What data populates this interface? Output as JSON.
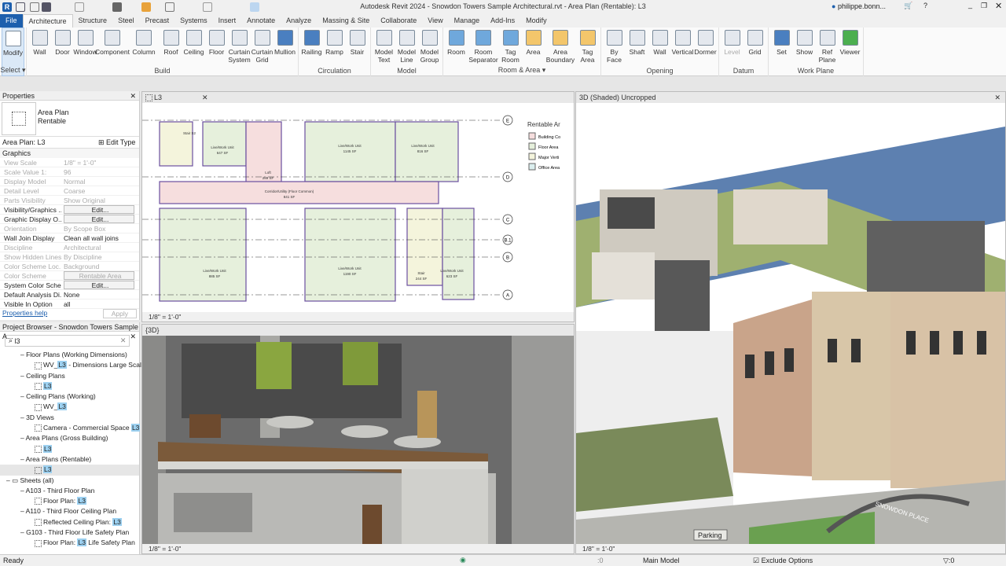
{
  "app": {
    "title": "Autodesk Revit 2024 - Snowdon Towers Sample Architectural.rvt - Area Plan (Rentable): L3",
    "user": "philippe.bonn...",
    "logo": "R"
  },
  "tabs": [
    "File",
    "Architecture",
    "Structure",
    "Steel",
    "Precast",
    "Systems",
    "Insert",
    "Annotate",
    "Analyze",
    "Massing & Site",
    "Collaborate",
    "View",
    "Manage",
    "Add-Ins",
    "Modify"
  ],
  "active_tab": "Architecture",
  "ribbon": [
    {
      "panel": "Select ▾",
      "buttons": [
        {
          "label": "Modify",
          "icon": "cursor-icon",
          "sel": true
        }
      ]
    },
    {
      "panel": "Build",
      "buttons": [
        {
          "label": "Wall",
          "icon": "wall-icon"
        },
        {
          "label": "Door",
          "icon": "door-icon"
        },
        {
          "label": "Window",
          "icon": "window-icon"
        },
        {
          "label": "Component",
          "icon": "component-icon",
          "wide": true
        },
        {
          "label": "Column",
          "icon": "column-icon",
          "wide": true
        },
        {
          "label": "Roof",
          "icon": "roof-icon"
        },
        {
          "label": "Ceiling",
          "icon": "ceiling-icon"
        },
        {
          "label": "Floor",
          "icon": "floor-icon"
        },
        {
          "label": "Curtain\nSystem",
          "icon": "curtain-system-icon"
        },
        {
          "label": "Curtain\nGrid",
          "icon": "curtain-grid-icon"
        },
        {
          "label": "Mullion",
          "icon": "mullion-icon"
        }
      ]
    },
    {
      "panel": "Circulation",
      "buttons": [
        {
          "label": "Railing",
          "icon": "railing-icon"
        },
        {
          "label": "Ramp",
          "icon": "ramp-icon"
        },
        {
          "label": "Stair",
          "icon": "stair-icon"
        }
      ]
    },
    {
      "panel": "Model",
      "buttons": [
        {
          "label": "Model\nText",
          "icon": "model-text-icon"
        },
        {
          "label": "Model\nLine",
          "icon": "model-line-icon"
        },
        {
          "label": "Model\nGroup",
          "icon": "model-group-icon"
        }
      ]
    },
    {
      "panel": "Room & Area ▾",
      "buttons": [
        {
          "label": "Room",
          "icon": "room-icon"
        },
        {
          "label": "Room\nSeparator",
          "icon": "room-separator-icon",
          "wide": true
        },
        {
          "label": "Tag\nRoom",
          "icon": "tag-room-icon"
        },
        {
          "label": "Area",
          "icon": "area-icon"
        },
        {
          "label": "Area\nBoundary",
          "icon": "area-boundary-icon",
          "wide": true
        },
        {
          "label": "Tag\nArea",
          "icon": "tag-area-icon"
        }
      ]
    },
    {
      "panel": "Opening",
      "buttons": [
        {
          "label": "By\nFace",
          "icon": "by-face-icon"
        },
        {
          "label": "Shaft",
          "icon": "shaft-icon"
        },
        {
          "label": "Wall",
          "icon": "wall-opening-icon"
        },
        {
          "label": "Vertical",
          "icon": "vertical-icon"
        },
        {
          "label": "Dormer",
          "icon": "dormer-icon"
        }
      ]
    },
    {
      "panel": "Datum",
      "buttons": [
        {
          "label": "Level",
          "icon": "level-icon",
          "dis": true
        },
        {
          "label": "Grid",
          "icon": "grid-icon"
        }
      ]
    },
    {
      "panel": "Work Plane",
      "buttons": [
        {
          "label": "Set",
          "icon": "set-icon"
        },
        {
          "label": "Show",
          "icon": "show-icon"
        },
        {
          "label": "Ref\nPlane",
          "icon": "ref-plane-icon"
        },
        {
          "label": "Viewer",
          "icon": "viewer-icon"
        }
      ]
    }
  ],
  "properties": {
    "header": "Properties",
    "type_line1": "Area Plan",
    "type_line2": "Rentable",
    "instance": "Area Plan: L3",
    "edit_type": "Edit Type",
    "group": "Graphics",
    "help": "Properties help",
    "apply": "Apply",
    "rows": [
      {
        "k": "View Scale",
        "v": "1/8\" = 1'-0\"",
        "gray": true
      },
      {
        "k": "Scale Value    1:",
        "v": "96",
        "gray": true
      },
      {
        "k": "Display Model",
        "v": "Normal",
        "gray": true
      },
      {
        "k": "Detail Level",
        "v": "Coarse",
        "gray": true
      },
      {
        "k": "Parts Visibility",
        "v": "Show Original",
        "gray": true
      },
      {
        "k": "Visibility/Graphics ...",
        "v": "Edit...",
        "btn": true
      },
      {
        "k": "Graphic Display O...",
        "v": "Edit...",
        "btn": true
      },
      {
        "k": "Orientation",
        "v": "By Scope Box",
        "gray": true
      },
      {
        "k": "Wall Join Display",
        "v": "Clean all wall joins"
      },
      {
        "k": "Discipline",
        "v": "Architectural",
        "gray": true
      },
      {
        "k": "Show Hidden Lines",
        "v": "By Discipline",
        "gray": true
      },
      {
        "k": "Color Scheme Loc...",
        "v": "Background",
        "gray": true
      },
      {
        "k": "Color Scheme",
        "v": "Rentable Area",
        "gray": true,
        "btn": true
      },
      {
        "k": "System Color Sche...",
        "v": "Edit...",
        "btn": true
      },
      {
        "k": "Default Analysis Di...",
        "v": "None"
      },
      {
        "k": "Visible In Option",
        "v": "all"
      }
    ]
  },
  "browser": {
    "header": "Project Browser - Snowdon Towers Sample A...",
    "search": "l3",
    "items": [
      {
        "indent": 1,
        "text": "Floor Plans (Working Dimensions)"
      },
      {
        "indent": 2,
        "pre": "WV_",
        "hl": "L3",
        "post": " - Dimensions Large Scale",
        "view": true
      },
      {
        "indent": 1,
        "text": "Ceiling Plans"
      },
      {
        "indent": 2,
        "hl": "L3",
        "view": true
      },
      {
        "indent": 1,
        "text": "Ceiling Plans (Working)"
      },
      {
        "indent": 2,
        "pre": "WV_",
        "hl": "L3",
        "view": true
      },
      {
        "indent": 1,
        "text": "3D Views"
      },
      {
        "indent": 2,
        "pre": "Camera - Commercial Space ",
        "hl": "L3",
        "view": true
      },
      {
        "indent": 1,
        "text": "Area Plans (Gross Building)"
      },
      {
        "indent": 2,
        "hl": "L3",
        "view": true
      },
      {
        "indent": 1,
        "text": "Area Plans (Rentable)"
      },
      {
        "indent": 2,
        "hl": "L3",
        "view": true,
        "selected": true
      },
      {
        "indent": 0,
        "text": "Sheets (all)"
      },
      {
        "indent": 1,
        "text": "A103 - Third Floor Plan"
      },
      {
        "indent": 2,
        "pre": "Floor Plan: ",
        "hl": "L3",
        "view": true
      },
      {
        "indent": 1,
        "text": "A110 - Third Floor Ceiling Plan"
      },
      {
        "indent": 2,
        "pre": "Reflected Ceiling Plan: ",
        "hl": "L3",
        "view": true
      },
      {
        "indent": 1,
        "text": "G103 - Third Floor Life Safety Plan"
      },
      {
        "indent": 2,
        "pre": "Floor Plan: ",
        "hl": "L3",
        "post": " Life Safety Plan",
        "view": true
      }
    ]
  },
  "views": {
    "plan": {
      "tab": "L3",
      "scale": "1/8\" = 1'-0\"",
      "legend_title": "Rentable Ar",
      "legend": [
        {
          "label": "Building Co",
          "color": "#f6dede"
        },
        {
          "label": "Floor Area",
          "color": "#e6f0dc"
        },
        {
          "label": "Major Verti",
          "color": "#f4f4dc"
        },
        {
          "label": "Office Area",
          "color": "#dcefef"
        }
      ],
      "grids": [
        "E",
        "D",
        "C",
        "B.1",
        "B",
        "A"
      ],
      "rooms": [
        {
          "name": "Live/Work Unit",
          "area": "647 SF"
        },
        {
          "name": "Loft",
          "area": "289 SF"
        },
        {
          "name": "Live/Work Unit",
          "area": "1145 SF"
        },
        {
          "name": "Live/Work Unit",
          "area": "816 SF"
        },
        {
          "name": "Corridor/Utility (Floor Common)",
          "area": "841 SF"
        },
        {
          "name": "Live/Work Unit",
          "area": "885 SF"
        },
        {
          "name": "Live/Work Unit",
          "area": "1190 SF"
        },
        {
          "name": "Stair",
          "area": "244 SF"
        },
        {
          "name": "Live/Work Unit",
          "area": "623 SF"
        },
        {
          "name": "Stair S2",
          "area": ""
        }
      ]
    },
    "camera": {
      "tab": "{3D}",
      "scale": "1/8\" = 1'-0\""
    },
    "shaded": {
      "tab": "3D (Shaded) Uncropped",
      "scale": "1/8\" = 1'-0\"",
      "signs": [
        "SNOWDON PLACE",
        "Parking"
      ]
    }
  },
  "status": {
    "text": "Ready",
    "model": "Main Model",
    "zero": ":0",
    "exclude": "Exclude Options",
    "filter": ":0"
  },
  "colors": {
    "file_tab": "#1d5fad",
    "accent": "#1d5fad",
    "highlight": "#9cd0f0"
  }
}
